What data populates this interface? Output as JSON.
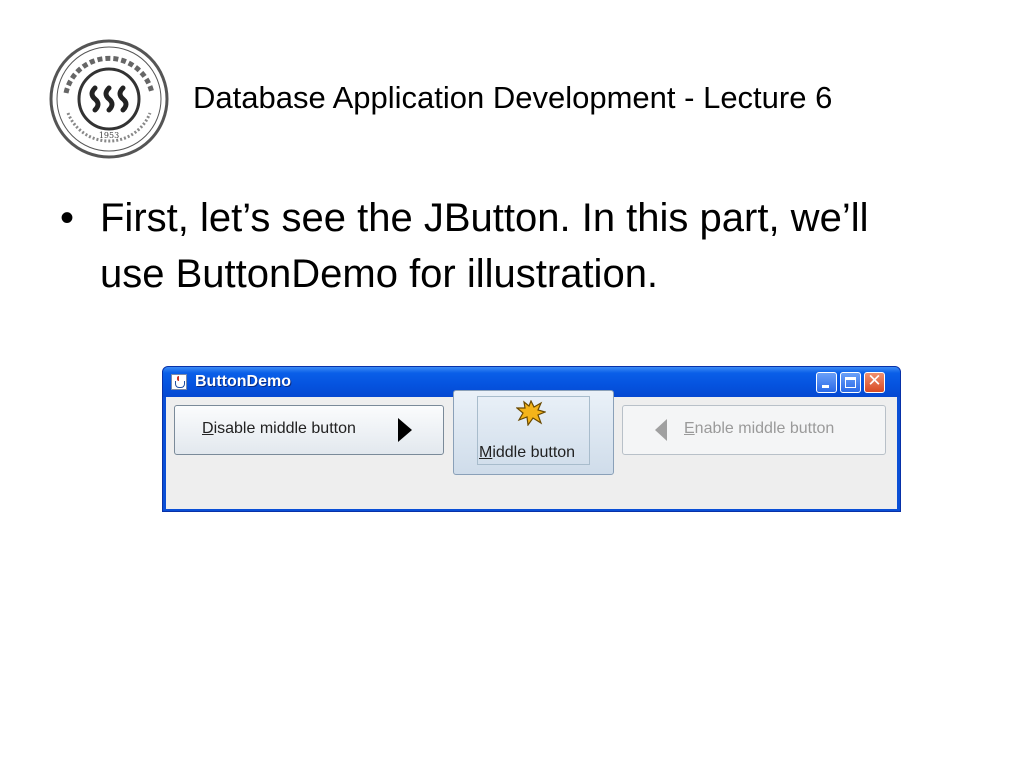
{
  "slide": {
    "title": "Database Application Development - Lecture 6",
    "bullet_symbol": "•",
    "bullet_text": "First, let’s see the JButton. In this part, we’ll use ButtonDemo for illustration.",
    "logo": {
      "center_text": "SSS",
      "year": "1953",
      "icon": "college-seal"
    }
  },
  "window": {
    "title": "ButtonDemo",
    "icons": {
      "app": "java-cup-icon",
      "minimize": "minimize-icon",
      "maximize": "maximize-icon",
      "close": "close-icon"
    },
    "close_glyph": "✕",
    "buttons": {
      "disable": {
        "mnemonic": "D",
        "rest": "isable middle button",
        "icon": "arrow-right-icon"
      },
      "middle": {
        "mnemonic": "M",
        "rest": "iddle button",
        "icon": "burst-icon"
      },
      "enable": {
        "mnemonic": "E",
        "rest": "nable middle button",
        "icon": "arrow-left-icon",
        "enabled": false
      }
    }
  }
}
